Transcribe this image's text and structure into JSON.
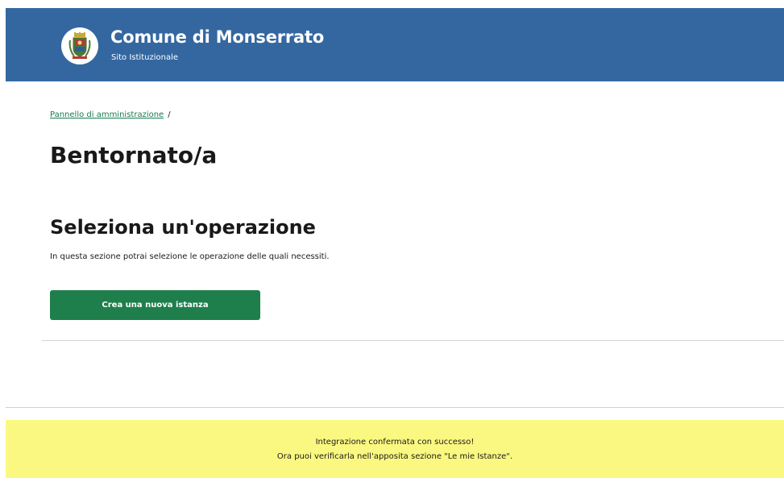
{
  "header": {
    "site_title": "Comune di Monserrato",
    "site_subtitle": "Sito Istituzionale",
    "logo_icon": "municipal-crest-icon",
    "background_color": "#3467a0"
  },
  "breadcrumb": {
    "items": [
      "Pannello di amministrazione"
    ],
    "separator": "/"
  },
  "main": {
    "welcome_title": "Bentornato/a",
    "section_title": "Seleziona un'operazione",
    "section_description": "In questa sezione potrai selezione le operazione delle quali necessiti.",
    "create_button_label": "Crea una nuova istanza",
    "button_color": "#1f7f4c"
  },
  "notice": {
    "line1": "Integrazione confermata con successo!",
    "line2": "Ora puoi verificarla nell'apposita sezione \"Le mie Istanze\".",
    "background_color": "#fbf881"
  }
}
